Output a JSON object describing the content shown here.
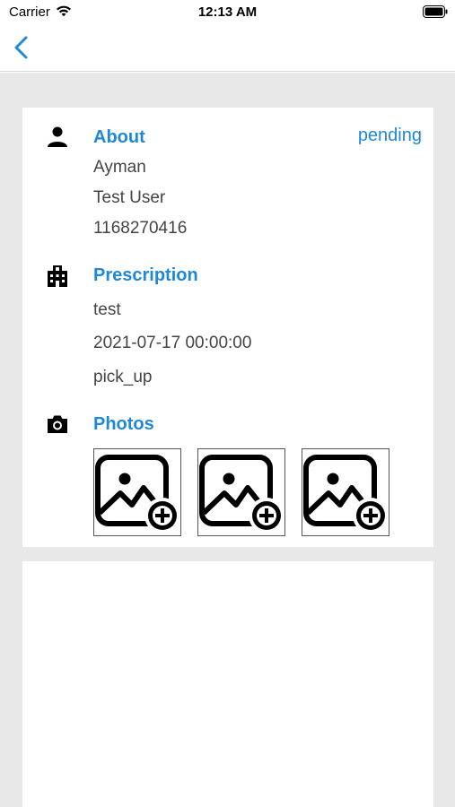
{
  "status_bar": {
    "carrier": "Carrier",
    "time": "12:13 AM"
  },
  "nav": {
    "back_icon": "chevron-left-icon"
  },
  "about": {
    "title": "About",
    "status": "pending",
    "first_name": "Ayman",
    "full_name": "Test User",
    "phone": "1168270416",
    "icon": "person-icon"
  },
  "prescription": {
    "title": "Prescription",
    "note": "test",
    "date": "2021-07-17 00:00:00",
    "delivery": "pick_up",
    "icon": "building-icon"
  },
  "photos": {
    "title": "Photos",
    "icon": "camera-icon",
    "slots": [
      "add-photo-icon",
      "add-photo-icon",
      "add-photo-icon"
    ]
  },
  "colors": {
    "accent": "#1f88d8",
    "background": "#e8e8e8",
    "card": "#ffffff",
    "text": "#444444"
  }
}
